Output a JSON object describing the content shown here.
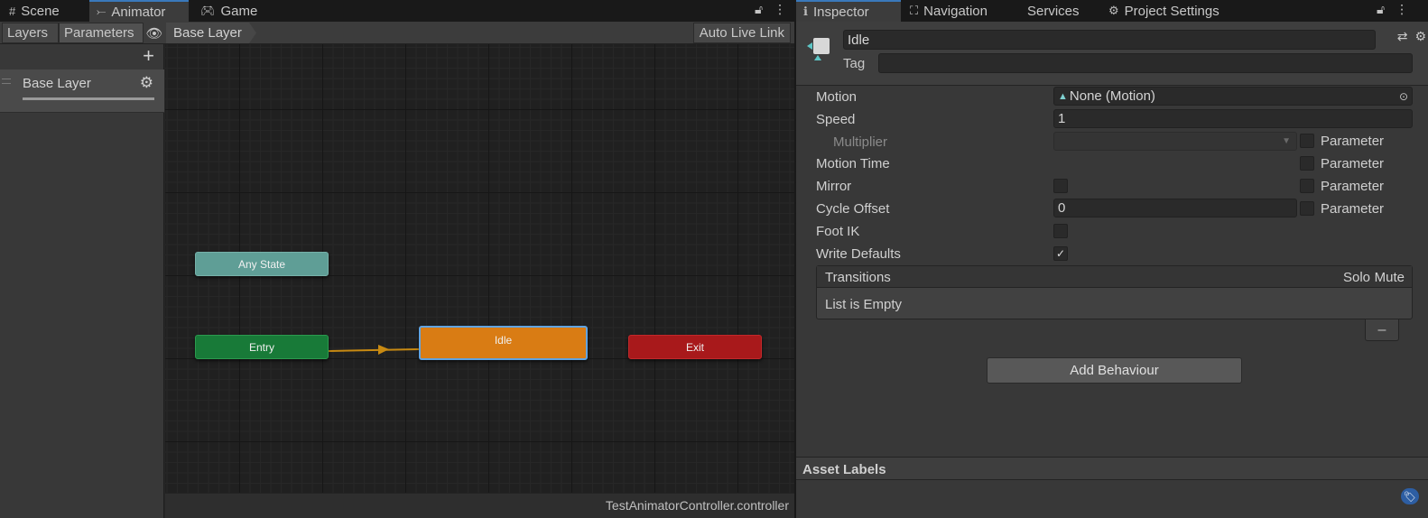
{
  "left_window": {
    "tabs": [
      {
        "label": "Scene",
        "icon": "grid-icon"
      },
      {
        "label": "Animator",
        "icon": "animator-icon"
      },
      {
        "label": "Game",
        "icon": "gamepad-icon"
      }
    ],
    "toolbar": {
      "layers_label": "Layers",
      "parameters_label": "Parameters",
      "breadcrumb": "Base Layer",
      "auto_live_link": "Auto Live Link"
    },
    "layers": [
      {
        "name": "Base Layer"
      }
    ],
    "graph": {
      "nodes": {
        "any_state": "Any State",
        "entry": "Entry",
        "idle": "Idle",
        "exit": "Exit"
      }
    },
    "status": {
      "file": "TestAnimatorController.controller"
    }
  },
  "right_window": {
    "tabs": [
      {
        "label": "Inspector",
        "icon": "info-icon"
      },
      {
        "label": "Navigation",
        "icon": "navigation-icon"
      },
      {
        "label": "Services",
        "icon": ""
      },
      {
        "label": "Project Settings",
        "icon": "gear-icon"
      }
    ],
    "header": {
      "name": "Idle",
      "tag_label": "Tag",
      "tag_value": ""
    },
    "properties": {
      "motion_label": "Motion",
      "motion_value": "None (Motion)",
      "speed_label": "Speed",
      "speed_value": "1",
      "multiplier_label": "Multiplier",
      "motion_time_label": "Motion Time",
      "mirror_label": "Mirror",
      "cycle_offset_label": "Cycle Offset",
      "cycle_offset_value": "0",
      "foot_ik_label": "Foot IK",
      "write_defaults_label": "Write Defaults",
      "write_defaults_checked": true,
      "parameter_label": "Parameter"
    },
    "transitions": {
      "title": "Transitions",
      "solo": "Solo",
      "mute": "Mute",
      "empty": "List is Empty",
      "remove": "–"
    },
    "add_behaviour": "Add Behaviour",
    "asset_labels": "Asset Labels"
  },
  "colors": {
    "accent": "#3a79bb",
    "any_state": "#5f9e96",
    "entry": "#187a38",
    "idle": "#d97c14",
    "exit": "#a8191b",
    "transition": "#c88a12"
  }
}
